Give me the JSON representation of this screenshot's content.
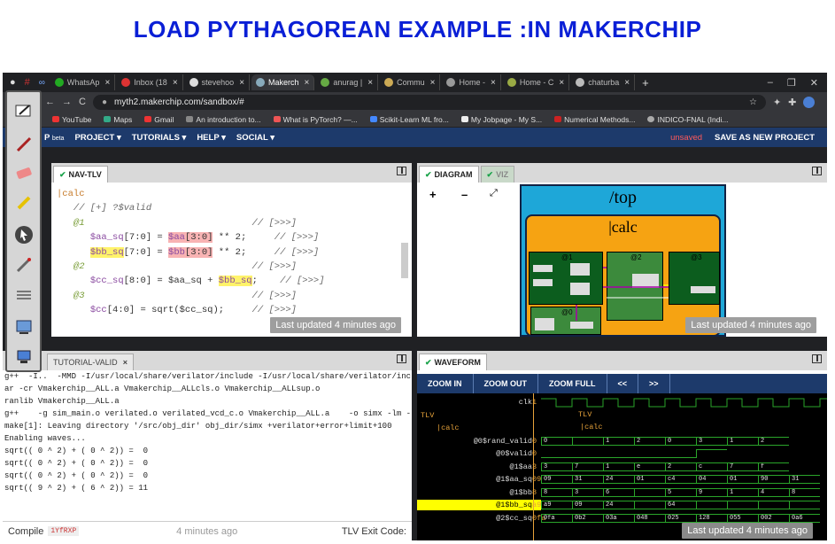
{
  "slide": {
    "title": "LOAD PYTHAGOREAN EXAMPLE :IN MAKERCHIP"
  },
  "browser": {
    "tabs": [
      {
        "label": "WhatsAp"
      },
      {
        "label": "Inbox (18"
      },
      {
        "label": "stevehoo"
      },
      {
        "label": "Makerch"
      },
      {
        "label": "anurag |"
      },
      {
        "label": "Commu"
      },
      {
        "label": "Home - "
      },
      {
        "label": "Home - C"
      },
      {
        "label": "chaturba"
      }
    ],
    "url": "myth2.makerchip.com/sandbox/#",
    "bookmarks": [
      {
        "label": "YouTube"
      },
      {
        "label": "Maps"
      },
      {
        "label": "Gmail"
      },
      {
        "label": "An introduction to..."
      },
      {
        "label": "What is PyTorch? —..."
      },
      {
        "label": "Scikit-Learn ML fro..."
      },
      {
        "label": "My Jobpage - My S..."
      },
      {
        "label": "Numerical Methods..."
      },
      {
        "label": "INDICO-FNAL (Indi..."
      }
    ],
    "apps_label": "Apps"
  },
  "app": {
    "brand_suffix": "beta",
    "brand_letter": "P",
    "menu": [
      "PROJECT ▾",
      "TUTORIALS ▾",
      "HELP ▾",
      "SOCIAL ▾"
    ],
    "unsaved": "unsaved",
    "save_as": "SAVE AS NEW PROJECT"
  },
  "editor": {
    "tab": "NAV-TLV",
    "toast": "Last updated 4 minutes ago",
    "lines": {
      "l1": "|calc",
      "l2": "// [+] ?$valid",
      "l3": "@1",
      "l3c": "// [>>>]",
      "l4a": "$aa_sq",
      "l4b": "[7:0] = ",
      "l4c": "$aa",
      "l4d": "[3:0]",
      "l4e": " ** 2;",
      "l4c2": "// [>>>]",
      "l5a": "$bb_sq",
      "l5b": "[7:0] = ",
      "l5c": "$bb",
      "l5d": "[3:0]",
      "l5e": " ** 2;",
      "l5c2": "// [>>>]",
      "l6": "@2",
      "l6c": "// [>>>]",
      "l7a": "$cc_sq",
      "l7b": "[8:0] = $aa_sq + ",
      "l7c": "$bb_sq",
      "l7d": ";",
      "l7c2": "// [>>>]",
      "l8": "@3",
      "l8c": "// [>>>]",
      "l9a": "$cc",
      "l9b": "[4:0] = sqrt($cc_sq);",
      "l9c": "// [>>>]"
    }
  },
  "diagram": {
    "tab_active": "DIAGRAM",
    "tab_other": "VIZ",
    "top_label": "/top",
    "calc_label": "|calc",
    "stages": [
      "@1",
      "@2",
      "@3",
      "@0"
    ],
    "toast": "Last updated 4 minutes ago"
  },
  "log": {
    "tab": "TUTORIAL-VALID",
    "lines": [
      "g++  -I..  -MMD -I/usr/local/share/verilator/include -I/usr/local/share/verilator/include",
      "ar -cr Vmakerchip__ALL.a Vmakerchip__ALLcls.o Vmakerchip__ALLsup.o",
      "ranlib Vmakerchip__ALL.a",
      "g++    -g sim_main.o verilated.o verilated_vcd_c.o Vmakerchip__ALL.a    -o simx -lm -lst",
      "make[1]: Leaving directory '/src/obj_dir' obj_dir/simx +verilator+error+limit+100",
      "Enabling waves...",
      "sqrt(( 0 ^ 2) + ( 0 ^ 2)) =  0",
      "sqrt(( 0 ^ 2) + ( 0 ^ 2)) =  0",
      "sqrt(( 0 ^ 2) + ( 0 ^ 2)) =  0",
      "sqrt(( 9 ^ 2) + ( 6 ^ 2)) = 11"
    ],
    "footer_compile": "Compile",
    "footer_id": "1YfRXP",
    "footer_time": "4 minutes ago",
    "footer_exit": "TLV Exit Code:"
  },
  "waveform": {
    "tab": "WAVEFORM",
    "buttons": [
      "ZOOM IN",
      "ZOOM OUT",
      "ZOOM FULL",
      "<<",
      ">>"
    ],
    "signals": [
      {
        "name": "clk",
        "val": "1"
      },
      {
        "name": "TLV",
        "val": ""
      },
      {
        "name": "|calc",
        "val": ""
      },
      {
        "name": "@0$rand_valid",
        "val": "0"
      },
      {
        "name": "@0$valid",
        "val": "0"
      },
      {
        "name": "@1$aa",
        "val": "3"
      },
      {
        "name": "@1$aa_sq",
        "val": "09"
      },
      {
        "name": "@1$bb",
        "val": "8"
      },
      {
        "name": "@1$bb_sq",
        "val": "a9"
      },
      {
        "name": "@2$cc_sq",
        "val": "0fa"
      }
    ],
    "lanes": {
      "aa": [
        "3",
        "7",
        "1",
        "e",
        "2",
        "c",
        "7",
        "f"
      ],
      "aa_sq": [
        "09",
        "31",
        "24",
        "01",
        "c4",
        "04",
        "01",
        "90",
        "31"
      ],
      "bb": [
        "8",
        "3",
        "6",
        "",
        "5",
        "9",
        "1",
        "4",
        "8"
      ],
      "bb_sq": [
        "a9",
        "09",
        "24",
        "",
        "64",
        "",
        "",
        "",
        ""
      ],
      "cc_sq": [
        "0fa",
        "0b2",
        "03a",
        "048",
        "025",
        "128",
        "055",
        "002",
        "0a6"
      ],
      "rand_valid": [
        "0",
        "",
        "1",
        "2",
        "0",
        "3",
        "1",
        "2"
      ]
    },
    "toast": "Last updated 4 minutes ago"
  }
}
